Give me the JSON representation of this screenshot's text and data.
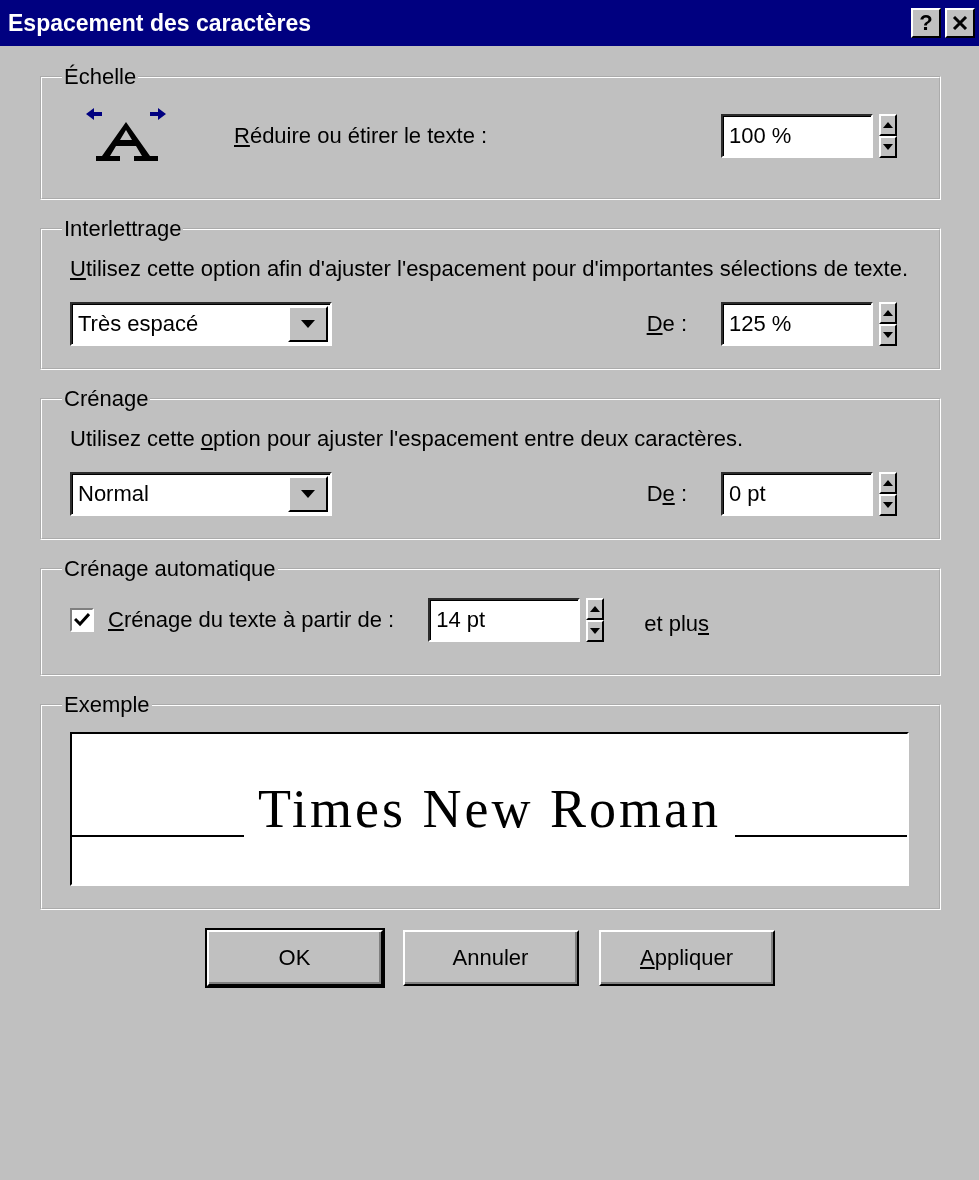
{
  "window": {
    "title": "Espacement des caractères",
    "help_button": "?"
  },
  "groups": [
    {
      "kind": "scale",
      "title": "Échelle",
      "label": {
        "key": "R",
        "after": "éduire ou étirer le texte :"
      },
      "value": "100 %"
    },
    {
      "kind": "spacing",
      "title": "Interlettrage",
      "description": {
        "key": "U",
        "after": "tilisez cette option afin d'ajuster l'espacement pour d'importantes sélections de texte."
      },
      "dropdown": "Très espacé",
      "by_label": {
        "key": "D",
        "after": "e :"
      },
      "value": "125 %"
    },
    {
      "kind": "spacing",
      "title": "Crénage",
      "description": {
        "before": "Utilisez cette ",
        "key": "o",
        "after": "ption pour ajuster l'espacement entre deux caractères."
      },
      "dropdown": "Normal",
      "by_label": {
        "before": "D",
        "key": "e",
        "after": " :"
      },
      "value": "0 pt"
    },
    {
      "kind": "auto",
      "title": "Crénage automatique",
      "checked": true,
      "label": {
        "key": "C",
        "after": "rénage du texte à partir de :"
      },
      "value": "14 pt",
      "suffix": {
        "before": "et plu",
        "key": "s"
      }
    },
    {
      "kind": "preview",
      "title": "Exemple",
      "sample": "Times New Roman"
    }
  ],
  "buttons": [
    {
      "label": {
        "after": "OK"
      },
      "default": true
    },
    {
      "label": {
        "after": "Annuler"
      },
      "default": false
    },
    {
      "label": {
        "key": "A",
        "after": "ppliquer"
      },
      "default": false
    }
  ]
}
